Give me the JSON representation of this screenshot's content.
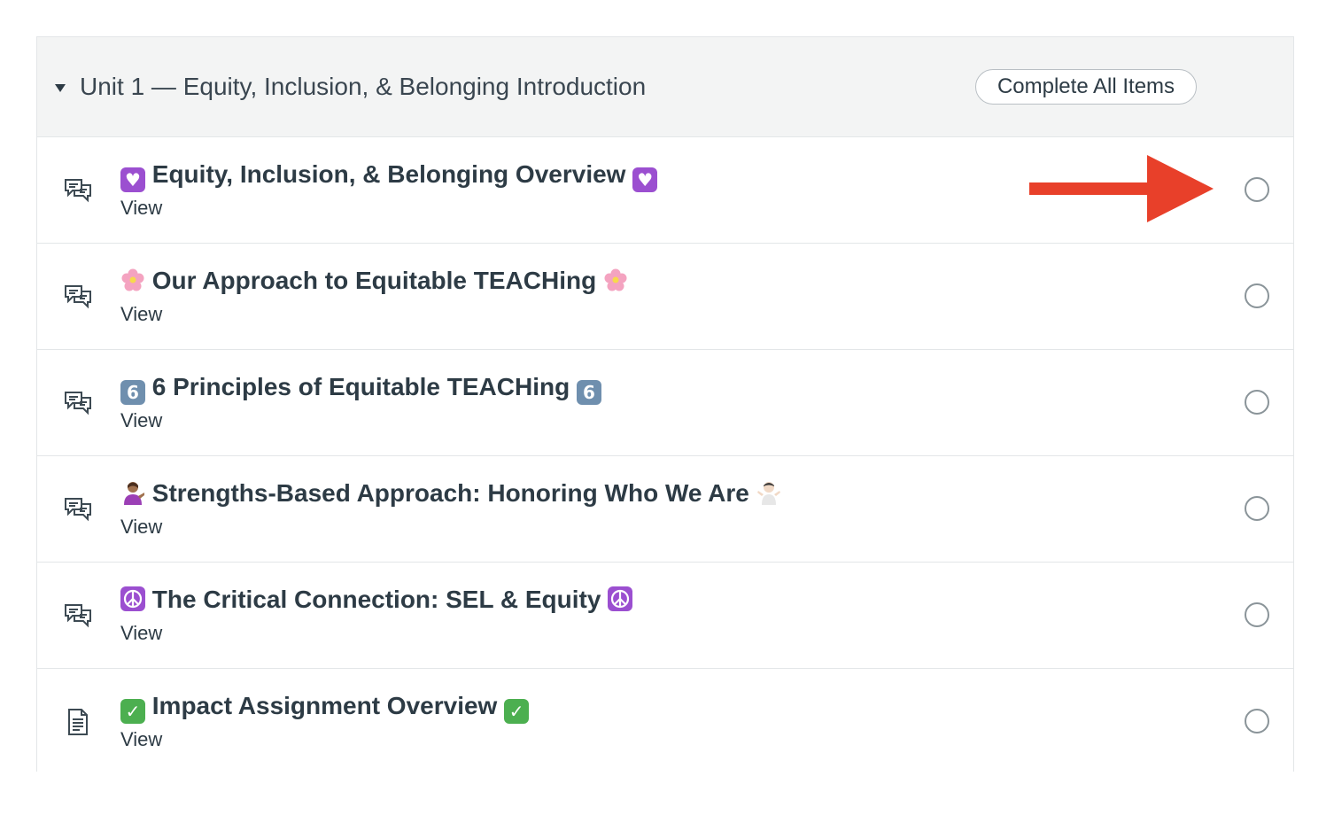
{
  "module": {
    "title": "Unit 1 — Equity, Inclusion, & Belonging Introduction",
    "complete_all_label": "Complete All Items",
    "items": [
      {
        "title": "Equity, Inclusion, & Belonging Overview",
        "leading_icon": "heart-emoji-icon",
        "trailing_icon": "heart-emoji-icon",
        "type_icon": "discussion-icon",
        "view_label": "View",
        "completed": false
      },
      {
        "title": "Our Approach to Equitable TEACHing",
        "leading_icon": "blossom-emoji-icon",
        "trailing_icon": "blossom-emoji-icon",
        "type_icon": "discussion-icon",
        "view_label": "View",
        "completed": false
      },
      {
        "title": "6 Principles of Equitable TEACHing",
        "leading_icon": "keycap-six-emoji-icon",
        "trailing_icon": "keycap-six-emoji-icon",
        "type_icon": "discussion-icon",
        "view_label": "View",
        "completed": false
      },
      {
        "title": "Strengths-Based Approach: Honoring Who We Are",
        "leading_icon": "person-tipping-hand-emoji-icon",
        "trailing_icon": "person-shrugging-emoji-icon",
        "type_icon": "discussion-icon",
        "view_label": "View",
        "completed": false
      },
      {
        "title": "The Critical Connection: SEL & Equity",
        "leading_icon": "peace-symbol-emoji-icon",
        "trailing_icon": "peace-symbol-emoji-icon",
        "type_icon": "discussion-icon",
        "view_label": "View",
        "completed": false
      },
      {
        "title": "Impact Assignment Overview",
        "leading_icon": "check-mark-emoji-icon",
        "trailing_icon": "check-mark-emoji-icon",
        "type_icon": "page-icon",
        "view_label": "View",
        "completed": false
      }
    ]
  },
  "colors": {
    "header_bg": "#f3f4f4",
    "text": "#2d3b45",
    "border": "#e3e6e8",
    "annotation_arrow": "#e8402a"
  }
}
